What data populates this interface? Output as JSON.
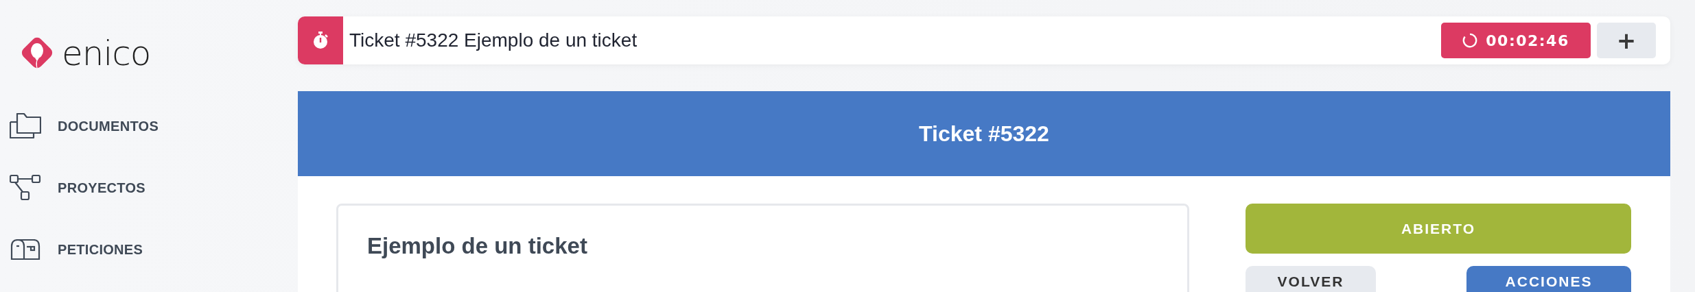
{
  "logo": {
    "text": "enico"
  },
  "sidebar": {
    "items": [
      {
        "label": "DOCUMENTOS",
        "kind": "folders"
      },
      {
        "label": "PROYECTOS",
        "kind": "nodes"
      },
      {
        "label": "PETICIONES",
        "kind": "mailbox"
      }
    ]
  },
  "timer_bar": {
    "title": "Ticket #5322 Ejemplo de un ticket",
    "time": "00:02:46",
    "add_label": "+"
  },
  "header": {
    "title": "Ticket #5322"
  },
  "ticket": {
    "title": "Ejemplo de un ticket"
  },
  "status": {
    "label": "ABIERTO"
  },
  "buttons": [
    {
      "label": "VOLVER",
      "kind": "secondary"
    },
    {
      "label": "ACCIONES",
      "kind": "primary"
    }
  ]
}
